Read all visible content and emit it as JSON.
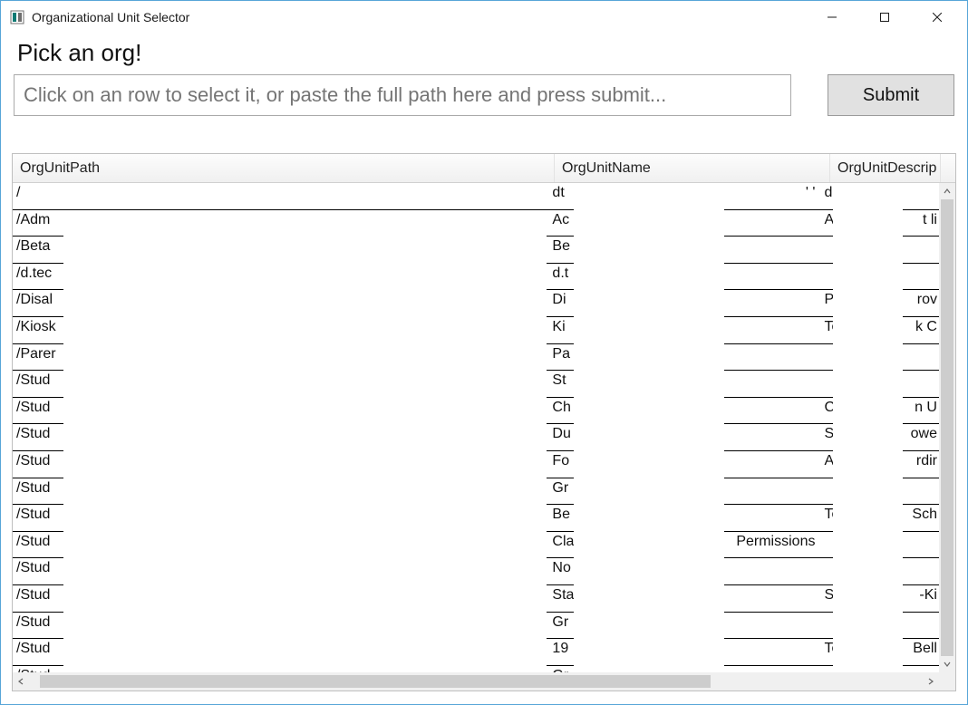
{
  "window": {
    "title": "Organizational Unit Selector",
    "minimize": "—",
    "maximize": "▢",
    "close": "✕"
  },
  "headline": "Pick an org!",
  "path_placeholder": "Click on an row to select it, or paste the full path here and press submit...",
  "submit_label": "Submit",
  "columns": {
    "c1": "OrgUnitPath",
    "c2": "OrgUnitName",
    "c3": "OrgUnitDescrip"
  },
  "rows": [
    {
      "path": "/",
      "n1": "dt",
      "n2": "' '",
      "d1": "d",
      "d2": ""
    },
    {
      "path": "/Adm",
      "n1": "Ac",
      "n2": "",
      "d1": "A",
      "d2": "t li"
    },
    {
      "path": "/Beta",
      "n1": "Be",
      "n2": "",
      "d1": "",
      "d2": ""
    },
    {
      "path": "/d.tec",
      "n1": "d.t",
      "n2": "",
      "d1": "",
      "d2": ""
    },
    {
      "path": "/Disal",
      "n1": "Di",
      "n2": "",
      "d1": "P",
      "d2": "rov"
    },
    {
      "path": "/Kiosk",
      "n1": "Ki",
      "n2": "",
      "d1": "Te",
      "d2": "k C"
    },
    {
      "path": "/Parer",
      "n1": "Pa",
      "n2": "",
      "d1": "",
      "d2": ""
    },
    {
      "path": "/Stud",
      "n1": "St",
      "n2": "",
      "d1": "",
      "d2": ""
    },
    {
      "path": "/Stud",
      "n1": "Ch",
      "n2": "",
      "d1": "C",
      "d2": "n U"
    },
    {
      "path": "/Stud",
      "n1": "Du",
      "n2": "",
      "d1": "St",
      "d2": "owe"
    },
    {
      "path": "/Stud",
      "n1": "Fo",
      "n2": "",
      "d1": "A",
      "d2": "rdir"
    },
    {
      "path": "/Stud",
      "n1": "Gr",
      "n2": "",
      "d1": "",
      "d2": ""
    },
    {
      "path": "/Stud",
      "n1": "Be",
      "n2": "",
      "d1": "Te",
      "d2": "Sch"
    },
    {
      "path": "/Stud",
      "n1": "Cla",
      "n2": "Permissions",
      "d1": "",
      "d2": ""
    },
    {
      "path": "/Stud",
      "n1": "No",
      "n2": "",
      "d1": "",
      "d2": ""
    },
    {
      "path": "/Stud",
      "n1": "Sta",
      "n2": "",
      "d1": "St",
      "d2": "-Ki"
    },
    {
      "path": "/Stud",
      "n1": "Gr",
      "n2": "",
      "d1": "",
      "d2": ""
    },
    {
      "path": "/Stud",
      "n1": "19",
      "n2": "",
      "d1": "Te",
      "d2": "Bell"
    },
    {
      "path": "/Stud",
      "n1": "Gr",
      "n2": "",
      "d1": "",
      "d2": ""
    }
  ]
}
